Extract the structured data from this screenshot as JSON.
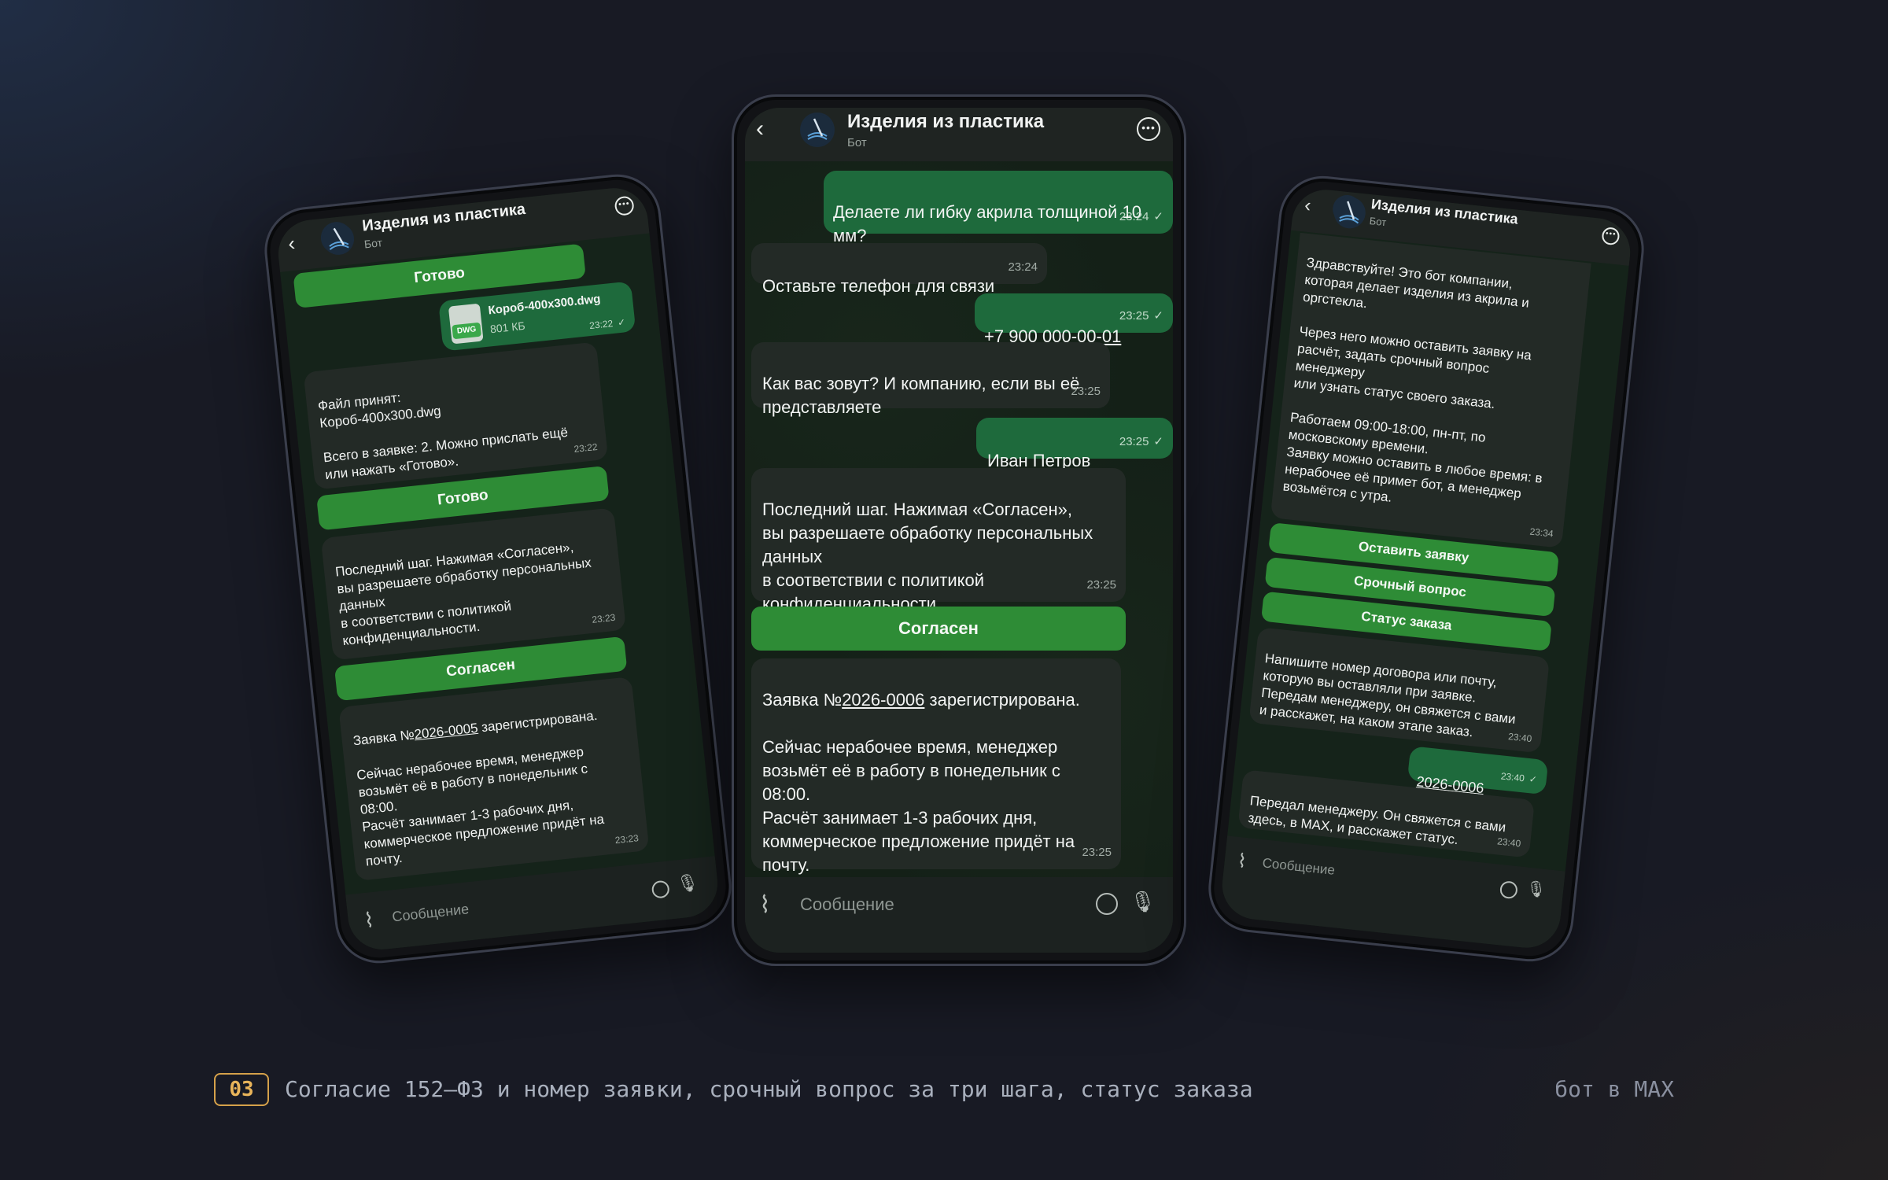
{
  "chat": {
    "title": "Изделия из пластика",
    "subtitle": "Бот",
    "composer_placeholder": "Сообщение"
  },
  "phone_left": {
    "messages": [
      {
        "type": "button",
        "label": "Готово"
      },
      {
        "type": "file",
        "direction": "out",
        "file_name": "Короб-400x300.dwg",
        "file_size": "801 КБ",
        "file_ext": "DWG",
        "time": "23:22"
      },
      {
        "type": "text",
        "direction": "in",
        "text": "Файл принят:\n  Короб-400x300.dwg\n\nВсего в заявке: 2. Можно прислать ещё\nили нажать «Готово».",
        "time": "23:22"
      },
      {
        "type": "button",
        "label": "Готово"
      },
      {
        "type": "text",
        "direction": "in",
        "text": "Последний шаг. Нажимая «Согласен»,\nвы разрешаете обработку персональных\nданных\nв соответствии с политикой\nконфиденциальности.",
        "time": "23:23"
      },
      {
        "type": "button",
        "label": "Согласен"
      },
      {
        "type": "text",
        "direction": "in",
        "prefix": "Заявка №",
        "link": "2026-0005",
        "suffix": " зарегистрирована.",
        "text": "\n\nСейчас нерабочее время, менеджер\nвозьмёт её в работу в понедельник с\n08:00.\nРасчёт занимает 1-3 рабочих дня,\nкоммерческое предложение придёт на\nпочту.",
        "time": "23:23"
      }
    ]
  },
  "phone_center": {
    "messages": [
      {
        "type": "text",
        "direction": "out",
        "text": "Делаете ли гибку акрила толщиной 10\nмм?",
        "time": "23:24"
      },
      {
        "type": "text",
        "direction": "in",
        "text": "Оставьте телефон для связи",
        "time": "23:24"
      },
      {
        "type": "text",
        "direction": "out",
        "link": "+7 900 000-00-01",
        "time": "23:25"
      },
      {
        "type": "text",
        "direction": "in",
        "text": "Как вас зовут? И компанию, если вы её\nпредставляете",
        "time": "23:25"
      },
      {
        "type": "text",
        "direction": "out",
        "text": "Иван Петров",
        "time": "23:25"
      },
      {
        "type": "text",
        "direction": "in",
        "text": "Последний шаг. Нажимая «Согласен»,\nвы разрешаете обработку персональных\nданных\nв соответствии с политикой\nконфиденциальности.",
        "time": "23:25"
      },
      {
        "type": "button",
        "label": "Согласен"
      },
      {
        "type": "text",
        "direction": "in",
        "prefix": "Заявка №",
        "link": "2026-0006",
        "suffix": " зарегистрирована.",
        "text": "\n\nСейчас нерабочее время, менеджер\nвозьмёт её в работу в понедельник с\n08:00.\nРасчёт занимает 1-3 рабочих дня,\nкоммерческое предложение придёт на\nпочту.",
        "time": "23:25"
      }
    ]
  },
  "phone_right": {
    "messages": [
      {
        "type": "text",
        "direction": "in",
        "text": "Здравствуйте! Это бот компании,\nкоторая делает изделия из акрила и\nоргстекла.\n\nЧерез него можно оставить заявку на\nрасчёт, задать срочный вопрос\nменеджеру\nили узнать статус своего заказа.\n\nРаботаем 09:00-18:00, пн-пт, по\nмосковскому времени.\nЗаявку можно оставить в любое время: в\nнерабочее её примет бот, а менеджер\nвозьмётся с утра.",
        "time": "23:34"
      },
      {
        "type": "button",
        "label": "Оставить заявку"
      },
      {
        "type": "button",
        "label": "Срочный вопрос"
      },
      {
        "type": "button",
        "label": "Статус заказа"
      },
      {
        "type": "text",
        "direction": "in",
        "text": "Напишите номер договора или почту,\nкоторую вы оставляли при заявке.\nПередам менеджеру, он свяжется с вами\nи расскажет, на каком этапе заказ.",
        "time": "23:40"
      },
      {
        "type": "text",
        "direction": "out",
        "link": "2026-0006",
        "time": "23:40"
      },
      {
        "type": "text",
        "direction": "in",
        "text": "Передал менеджеру. Он свяжется с вами\nздесь, в MAX, и расскажет статус.",
        "time": "23:40"
      }
    ]
  },
  "caption": {
    "number": "03",
    "text": "Согласие 152–ФЗ и номер заявки, срочный вопрос за три шага, статус заказа",
    "right": "бот в MAX"
  },
  "icons": {
    "back": "chevron-left-icon",
    "more": "more-horizontal-icon",
    "attach": "paperclip-icon",
    "emoji": "emoji-icon",
    "mic": "microphone-icon",
    "logo": "company-logo-icon"
  },
  "colors": {
    "accent_button": "#2e8c36",
    "outgoing_bubble": "#1e6a3c",
    "incoming_bubble": "#232a26",
    "badge": "#e8b45a"
  }
}
